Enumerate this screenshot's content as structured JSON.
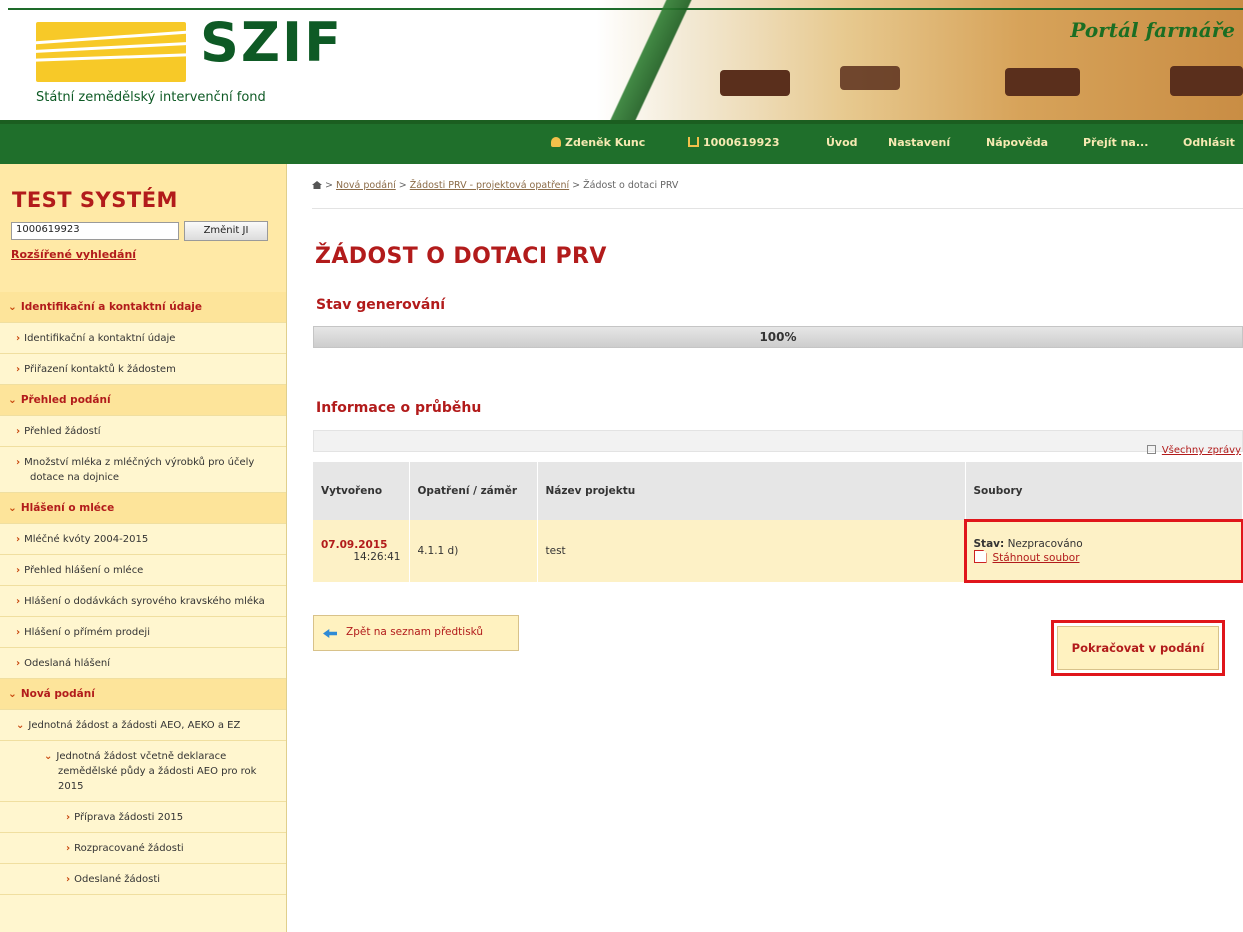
{
  "header": {
    "logo": "SZIF",
    "subtitle": "Státní zemědělský intervenční fond",
    "portal": "Portál farmáře"
  },
  "topnav": {
    "user": "Zdeněk Kunc",
    "id": "1000619923",
    "links": [
      "Úvod",
      "Nastavení",
      "Nápověda",
      "Přejít na...",
      "Odhlásit"
    ]
  },
  "sidebar": {
    "title": "TEST SYSTÉM",
    "search_value": "1000619923",
    "change_btn": "Změnit JI",
    "advanced": "Rozšířené vyhledání",
    "items": [
      {
        "label": "Identifikační a kontaktní údaje"
      },
      {
        "label": "Identifikační a kontaktní údaje"
      },
      {
        "label": "Přiřazení kontaktů k žádostem"
      },
      {
        "label": "Přehled podání"
      },
      {
        "label": "Přehled žádostí"
      },
      {
        "label": "Množství mléka z mléčných výrobků pro účely dotace na dojnice"
      },
      {
        "label": "Hlášení o mléce"
      },
      {
        "label": "Mléčné kvóty 2004-2015"
      },
      {
        "label": "Přehled hlášení o mléce"
      },
      {
        "label": "Hlášení o dodávkách syrového kravského mléka"
      },
      {
        "label": "Hlášení o přímém prodeji"
      },
      {
        "label": "Odeslaná hlášení"
      },
      {
        "label": "Nová podání"
      },
      {
        "label": "Jednotná žádost a žádosti AEO, AEKO a EZ"
      },
      {
        "label": "Jednotná žádost včetně deklarace zemědělské půdy a žádosti AEO pro rok 2015"
      },
      {
        "label": "Příprava žádosti 2015"
      },
      {
        "label": "Rozpracované žádosti"
      },
      {
        "label": "Odeslané žádosti"
      }
    ]
  },
  "breadcrumb": {
    "links": [
      "Nová podání",
      "Žádosti PRV - projektová opatření"
    ],
    "current": "Žádost o dotaci PRV"
  },
  "main": {
    "title": "ŽÁDOST O DOTACI PRV",
    "gen_heading": "Stav generování",
    "progress_label": "100%",
    "progress": 1.0,
    "info_heading": "Informace o průběhu",
    "all_messages": "Všechny zprávy"
  },
  "table": {
    "headers": [
      "Vytvořeno",
      "Opatření / záměr",
      "Název projektu",
      "Soubory"
    ],
    "rows": [
      {
        "date": "07.09.2015",
        "time": "14:26:41",
        "measure": "4.1.1 d)",
        "project": "test",
        "status_label": "Stav:",
        "status_value": "Nezpracováno",
        "download": "Stáhnout soubor"
      }
    ]
  },
  "buttons": {
    "back": "Zpět na seznam předtisků",
    "continue": "Pokračovat v podání"
  }
}
